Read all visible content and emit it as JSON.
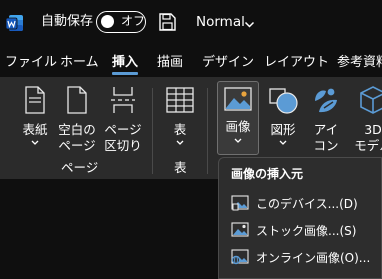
{
  "titlebar": {
    "autosave_label": "自動保存",
    "autosave_state": "オフ",
    "style_name": "Normal"
  },
  "tabs": [
    {
      "label": "ファイル"
    },
    {
      "label": "ホーム"
    },
    {
      "label": "挿入",
      "active": true
    },
    {
      "label": "描画"
    },
    {
      "label": "デザイン"
    },
    {
      "label": "レイアウト"
    },
    {
      "label": "参考資料"
    }
  ],
  "ribbon": {
    "pages_group": {
      "label": "ページ",
      "cover": {
        "line1": "表紙"
      },
      "blank_page": {
        "line1": "空白の",
        "line2": "ページ"
      },
      "page_break": {
        "line1": "ページ",
        "line2": "区切り"
      }
    },
    "tables_group": {
      "label": "表",
      "table": {
        "line1": "表"
      }
    },
    "illustrations_group": {
      "image": {
        "line1": "画像"
      },
      "shapes": {
        "line1": "図形"
      },
      "icons": {
        "line1": "アイ",
        "line2": "コン"
      },
      "models3d": {
        "line1": "3D",
        "line2": "モデル"
      }
    }
  },
  "image_menu": {
    "header": "画像の挿入元",
    "items": [
      {
        "label": "このデバイス...(D)",
        "icon": "device-picture-icon"
      },
      {
        "label": "ストック画像...(S)",
        "icon": "stock-images-icon"
      },
      {
        "label": "オンライン画像(O)...",
        "icon": "online-pictures-icon"
      }
    ]
  },
  "colors": {
    "accent": "#5b9bd5",
    "word_blue": "#185abd",
    "ribbon_bg": "#2b2b2b",
    "window_bg": "#0f0f0f"
  }
}
